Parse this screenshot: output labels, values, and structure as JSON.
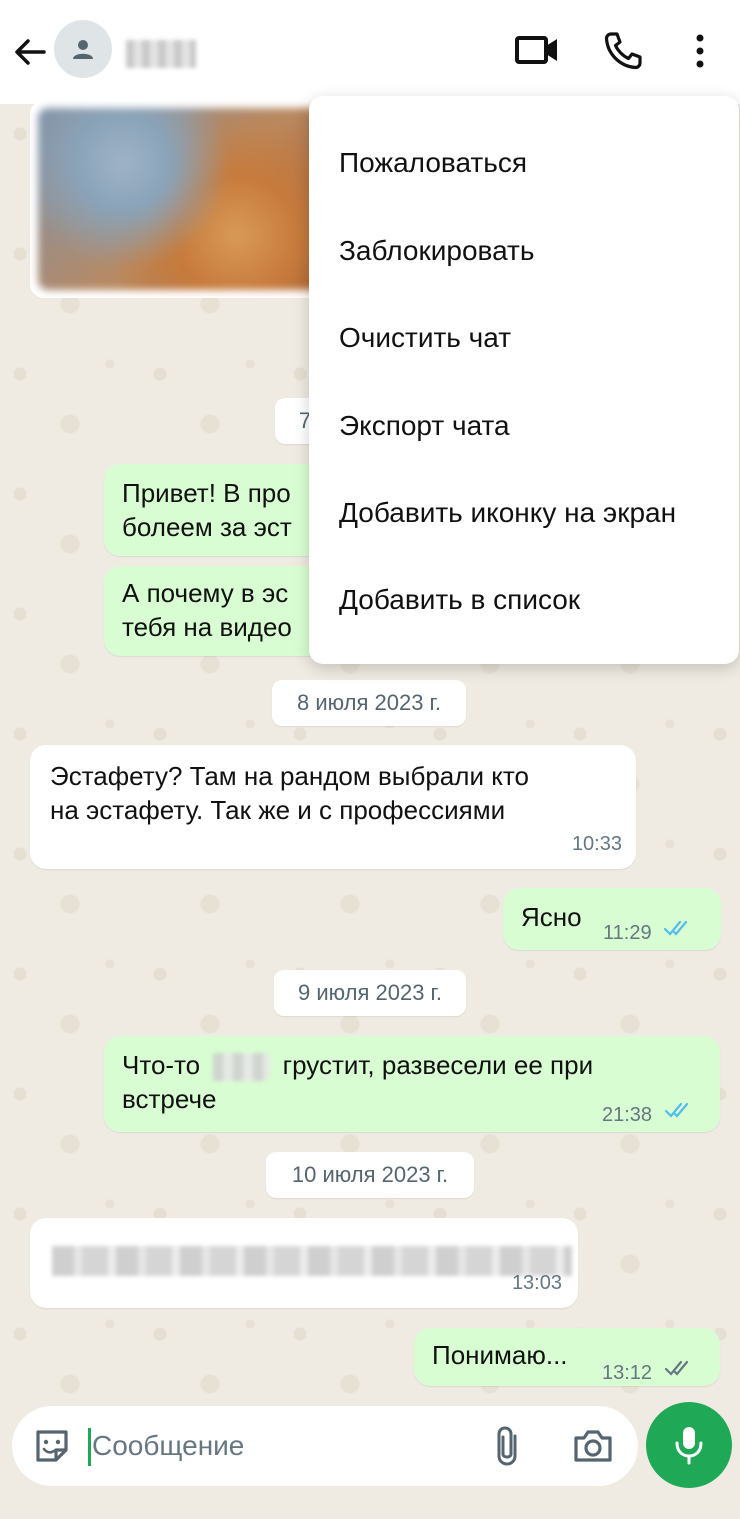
{
  "header": {
    "back_icon": "arrow-left-icon",
    "avatar_icon": "person-icon",
    "video_icon": "video-camera-icon",
    "call_icon": "phone-icon",
    "more_icon": "more-vert-icon"
  },
  "menu": {
    "items": [
      "Пожаловаться",
      "Заблокировать",
      "Очистить чат",
      "Экспорт чата",
      "Добавить иконку на экран",
      "Добавить в список"
    ]
  },
  "chat": {
    "dates": {
      "d7_partial": "7",
      "d8": "8 июля 2023 г.",
      "d9": "9 июля 2023 г.",
      "d10": "10 июля 2023 г."
    },
    "messages": [
      {
        "dir": "out",
        "line1": "Привет! В про",
        "line2": "болеем за эст"
      },
      {
        "dir": "out",
        "line1": "А почему в эс",
        "line2": "тебя на видео"
      },
      {
        "dir": "in",
        "line1": "Эстафету? Там на рандом выбрали кто",
        "line2": "на эстафету. Так же и с профессиями",
        "time": "10:33"
      },
      {
        "dir": "out",
        "text": "Ясно",
        "time": "11:29",
        "status": "read"
      },
      {
        "dir": "out",
        "before_name": "Что-то",
        "after_name": "грустит, развесели ее при",
        "line2": "встрече",
        "time": "21:38",
        "status": "read"
      },
      {
        "dir": "in",
        "time": "13:03"
      },
      {
        "dir": "out",
        "text": "Понимаю...",
        "time": "13:12",
        "status": "delivered"
      }
    ]
  },
  "composer": {
    "placeholder": "Сообщение",
    "sticker_icon": "sticker-icon",
    "attach_icon": "paperclip-icon",
    "camera_icon": "camera-icon",
    "mic_icon": "microphone-icon"
  },
  "colors": {
    "accent": "#1fa855",
    "outgoing_bubble": "#d9fdd3",
    "incoming_bubble": "#ffffff",
    "read_ticks": "#53bdeb",
    "delivered_ticks": "#667781"
  }
}
